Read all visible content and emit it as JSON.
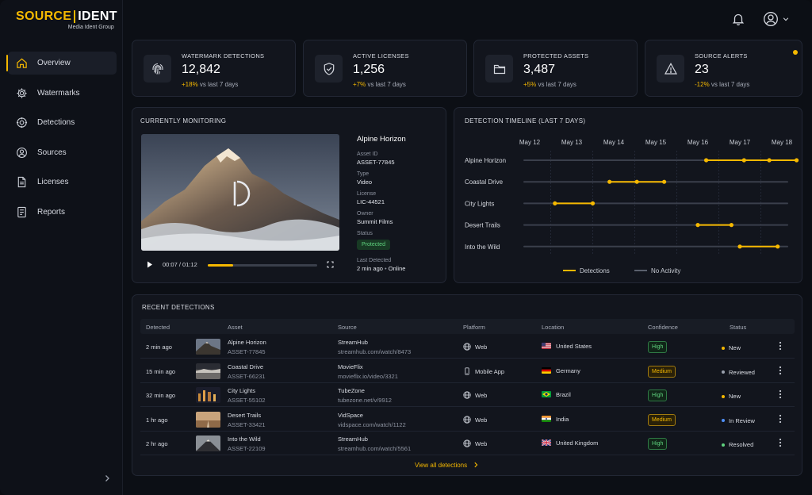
{
  "brand": {
    "name_left": "SOURCE",
    "name_right": "IDENT",
    "subtitle": "Media Ident Group",
    "accent": "#f5b800"
  },
  "sidebar": {
    "items": [
      {
        "label": "Overview",
        "icon": "home-icon",
        "active": true
      },
      {
        "label": "Watermarks",
        "icon": "gear-icon"
      },
      {
        "label": "Detections",
        "icon": "target-icon"
      },
      {
        "label": "Sources",
        "icon": "sources-icon"
      },
      {
        "label": "Licenses",
        "icon": "document-icon"
      },
      {
        "label": "Reports",
        "icon": "report-icon"
      }
    ]
  },
  "stats": [
    {
      "label": "WATERMARK DETECTIONS",
      "value": "12,842",
      "change": "+18%",
      "suffix": "vs last 7 days",
      "icon": "fingerprint-icon"
    },
    {
      "label": "ACTIVE LICENSES",
      "value": "1,256",
      "change": "+7%",
      "suffix": "vs last 7 days",
      "icon": "shield-check-icon"
    },
    {
      "label": "PROTECTED ASSETS",
      "value": "3,487",
      "change": "+5%",
      "suffix": "vs last 7 days",
      "icon": "folder-icon"
    },
    {
      "label": "SOURCE ALERTS",
      "value": "23",
      "change": "-12%",
      "suffix": "vs last 7 days",
      "icon": "warning-icon"
    }
  ],
  "monitoring": {
    "title": "CURRENTLY MONITORING",
    "asset_name": "Alpine Horizon",
    "time": "00:07 / 01:12",
    "progress": 0.23,
    "fields": [
      {
        "key": "Asset ID",
        "value": "ASSET-77845"
      },
      {
        "key": "Type",
        "value": "Video"
      },
      {
        "key": "License",
        "value": "LIC-44521"
      },
      {
        "key": "Owner",
        "value": "Summit Films"
      }
    ],
    "status_label": "Status",
    "status_value": "Protected",
    "last_label": "Last Detected",
    "last_value": "2 min ago",
    "last_state": "Online"
  },
  "timeline": {
    "title": "DETECTION TIMELINE (LAST 7 DAYS)",
    "dates": [
      "May 12",
      "May 13",
      "May 14",
      "May 15",
      "May 16",
      "May 17",
      "May 18"
    ],
    "rows": [
      {
        "label": "Alpine Horizon",
        "points": [
          4.2,
          5.1,
          5.7,
          6.35
        ],
        "seg": [
          4.2,
          6.35
        ]
      },
      {
        "label": "Coastal Drive",
        "points": [
          1.9,
          2.55,
          3.2
        ],
        "seg": [
          1.9,
          3.2
        ]
      },
      {
        "label": "City Lights",
        "points": [
          0.6,
          1.5
        ],
        "seg": [
          0.6,
          1.5
        ]
      },
      {
        "label": "Desert Trails",
        "points": [
          4.0,
          4.8
        ],
        "seg": [
          4.0,
          4.8
        ]
      },
      {
        "label": "Into the Wild",
        "points": [
          5.0,
          5.9
        ],
        "seg": [
          5.0,
          5.9
        ]
      }
    ],
    "legend_detections": "Detections",
    "legend_no_activity": "No Activity"
  },
  "recent": {
    "title": "RECENT DETECTIONS",
    "columns": [
      "Detected",
      "Asset",
      "Source",
      "Platform",
      "Location",
      "Confidence",
      "Status"
    ],
    "rows": [
      {
        "detected": "2 min ago",
        "asset": "Alpine Horizon",
        "asset_id": "ASSET-77845",
        "source": "StreamHub",
        "url": "streamhub.com/watch/8473",
        "platform": "Web",
        "platform_icon": "globe-icon",
        "location": "United States",
        "flag": "us",
        "confidence": "High",
        "status": "New",
        "status_color": "#f5b800"
      },
      {
        "detected": "15 min ago",
        "asset": "Coastal Drive",
        "asset_id": "ASSET-66231",
        "source": "MovieFlix",
        "url": "movieflix.io/video/3321",
        "platform": "Mobile App",
        "platform_icon": "phone-icon",
        "location": "Germany",
        "flag": "de",
        "confidence": "Medium",
        "status": "Reviewed",
        "status_color": "#9aa0ad"
      },
      {
        "detected": "32 min ago",
        "asset": "City Lights",
        "asset_id": "ASSET-55102",
        "source": "TubeZone",
        "url": "tubezone.net/v/9912",
        "platform": "Web",
        "platform_icon": "globe-icon",
        "location": "Brazil",
        "flag": "br",
        "confidence": "High",
        "status": "New",
        "status_color": "#f5b800"
      },
      {
        "detected": "1 hr ago",
        "asset": "Desert Trails",
        "asset_id": "ASSET-33421",
        "source": "VidSpace",
        "url": "vidspace.com/watch/1122",
        "platform": "Web",
        "platform_icon": "globe-icon",
        "location": "India",
        "flag": "in",
        "confidence": "Medium",
        "status": "In Review",
        "status_color": "#4f8ff7"
      },
      {
        "detected": "2 hr ago",
        "asset": "Into the Wild",
        "asset_id": "ASSET-22109",
        "source": "StreamHub",
        "url": "streamhub.com/watch/5561",
        "platform": "Web",
        "platform_icon": "globe-icon",
        "location": "United Kingdom",
        "flag": "gb",
        "confidence": "High",
        "status": "Resolved",
        "status_color": "#5fd37e"
      }
    ],
    "view_all": "View all detections"
  }
}
